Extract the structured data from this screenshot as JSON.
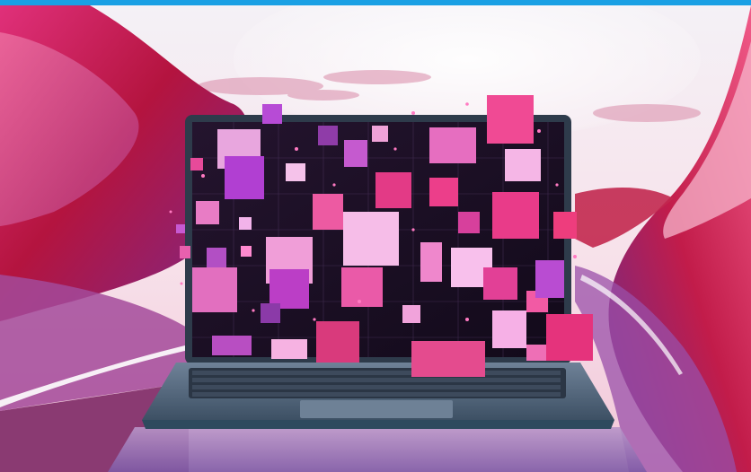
{
  "image": {
    "subject": "laptop-with-floating-pink-squares",
    "colors": {
      "top_bar": "#1aa0e4",
      "sky_top": "#f4f1f6",
      "sky_bottom": "#f7d9e4",
      "magenta": "#d0246a",
      "crimson": "#b4143f",
      "violet": "#6e3fa3",
      "pink_tile": "#f4a8e0",
      "hot_pink": "#e6307a",
      "laptop_body": "#5c6f86",
      "laptop_edge": "#2e4a5e",
      "screen_bg": "#1a0f24",
      "keyboard": "#2b3645"
    },
    "icons": [
      "laptop-icon",
      "floating-squares-icon"
    ]
  }
}
